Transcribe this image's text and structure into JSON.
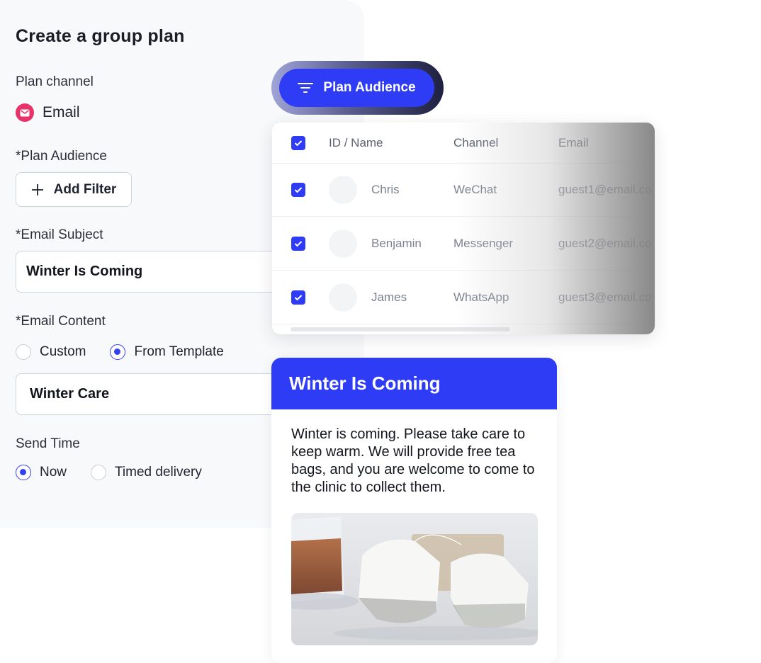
{
  "form": {
    "title": "Create a group plan",
    "plan_channel_label": "Plan channel",
    "channel_value": "Email",
    "channel_icon": "mail-icon",
    "audience_label": "*Plan Audience",
    "add_filter_label": "Add Filter",
    "subject_label": "*Email Subject",
    "subject_value": "Winter Is Coming",
    "content_label": "*Email Content",
    "content_options": [
      "Custom",
      "From Template"
    ],
    "content_selected": "From Template",
    "template_value": "Winter Care",
    "send_time_label": "Send Time",
    "send_options": [
      "Now",
      "Timed delivery"
    ],
    "send_selected": "Now"
  },
  "audience_button": {
    "label": "Plan Audience",
    "icon": "filter-icon"
  },
  "table": {
    "columns": [
      "ID / Name",
      "Channel",
      "Email"
    ],
    "rows": [
      {
        "name": "Chris",
        "channel": "WeChat",
        "email": "guest1@email.co",
        "checked": true
      },
      {
        "name": "Benjamin",
        "channel": "Messenger",
        "email": "guest2@email.co",
        "checked": true
      },
      {
        "name": "James",
        "channel": "WhatsApp",
        "email": "guest3@email.co",
        "checked": true
      }
    ]
  },
  "preview": {
    "title": "Winter Is Coming",
    "body": "Winter is coming. Please take care to keep warm. We will provide free tea bags, and you are welcome to come to the clinic to collect them."
  },
  "colors": {
    "accent": "#2f3cf5",
    "email_icon": "#e8336a",
    "panel_bg": "#f8f9fa"
  }
}
